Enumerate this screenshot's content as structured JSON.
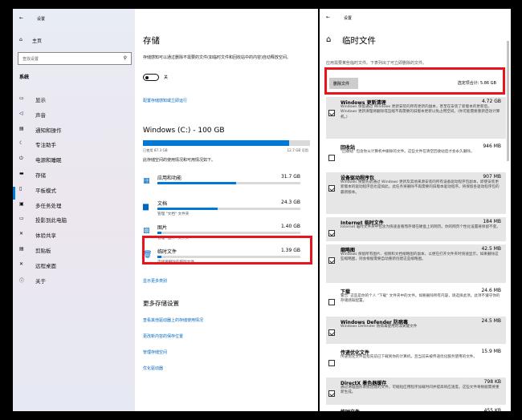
{
  "left_window": {
    "title": "设置",
    "back_icon": "back-arrow-icon",
    "home": "主页",
    "search_placeholder": "查找设置",
    "system_header": "系统",
    "nav": [
      {
        "icon": "display-icon",
        "label": "显示"
      },
      {
        "icon": "sound-icon",
        "label": "声音"
      },
      {
        "icon": "notifications-icon",
        "label": "通知和操作"
      },
      {
        "icon": "focus-assist-icon",
        "label": "专注助手"
      },
      {
        "icon": "power-icon",
        "label": "电源和睡眠"
      },
      {
        "icon": "storage-icon",
        "label": "存储"
      },
      {
        "icon": "tablet-icon",
        "label": "平板模式"
      },
      {
        "icon": "multitask-icon",
        "label": "多任务处理"
      },
      {
        "icon": "project-icon",
        "label": "投影到此电脑"
      },
      {
        "icon": "shared-icon",
        "label": "体验共享"
      },
      {
        "icon": "clipboard-icon",
        "label": "剪贴板"
      },
      {
        "icon": "remote-desktop-icon",
        "label": "远程桌面"
      },
      {
        "icon": "info-icon",
        "label": "关于"
      }
    ],
    "main": {
      "title": "存储",
      "description": "存储感知可以通过删除不需要的文件(如临时文件和回收站中的内容)自动释放空间。",
      "toggle_label": "关",
      "configure_link": "配置存储感知或立即运行",
      "drive_title": "Windows (C:) - 100 GB",
      "used": "已使用 87.3 GB",
      "free": "12.7 GB 可用",
      "used_fraction": 0.873,
      "drive_desc": "此存储空间的使用情况和可用情况如下。",
      "categories": [
        {
          "icon": "apps-icon",
          "name": "应用和功能",
          "size": "31.7 GB",
          "fraction": 0.55,
          "desc": ""
        },
        {
          "icon": "documents-icon",
          "name": "文档",
          "size": "24.3 GB",
          "fraction": 0.42,
          "desc": "管理 \"文档\" 文件夹"
        },
        {
          "icon": "pictures-icon",
          "name": "图片",
          "size": "1.40 GB",
          "fraction": 0.03,
          "desc": "管理 \"图片\" 文件夹"
        },
        {
          "icon": "trash-icon",
          "name": "临时文件",
          "size": "1.39 GB",
          "fraction": 0.03,
          "desc": "选择要删除的临时文件"
        }
      ],
      "show_more": "显示更多类别",
      "more_header": "更多存储设置",
      "more_links": [
        "查看其他驱动器上的存储使用情况",
        "更改新内容的保存位置",
        "管理存储空间",
        "优化驱动器"
      ]
    }
  },
  "right_window": {
    "title": "设置",
    "page_title": "临时文件",
    "intro": "应用需要某些临时文件。下表列出了可立即删除的文件。",
    "delete_button": "删除文件",
    "selected_total": "选定项合计: 5.86 GB",
    "items": [
      {
        "name": "Windows 更新清理",
        "size": "4.72 GB",
        "checked": true,
        "desc": "Windows 保留通过 Windows 更新安装的所有更新的副本，甚至在安装了新版本的更新后。Windows 更新清理将删除或压缩不再需要的旧版本更新以免占用空间。(你可能需要重新启动计算机。)"
      },
      {
        "name": "回收站",
        "size": "946 MB",
        "checked": false,
        "desc": "\"回收站\" 包含你从计算机中删除的文件。这些文件在清空回收站后才会永久删除。"
      },
      {
        "name": "设备驱动程序包",
        "size": "907 MB",
        "checked": true,
        "desc": "Windows 保留先前通过 Windows 更新及其他来源安装的所有设备驱动程序包副本，即使安装更新版本的驱动程序后也是如此。此任务将删除不再需要的旧版本驱动程序。将保留各驱动程序包的最新版本。"
      },
      {
        "name": "Internet 临时文件",
        "size": "184 MB",
        "checked": true,
        "desc": "Internet 临时文件夹中包含为快速查看而存储在硬盘上的网页。你的网页个性化设置将保留不变。"
      },
      {
        "name": "缩略图",
        "size": "42.5 MB",
        "checked": true,
        "desc": "Windows 保留所有图片、视频和文档缩略图的副本，以便在打开文件夹时快速显示。如果删除这些缩略图，则会根据需要自动重新创建这些缩略图。"
      },
      {
        "name": "下载",
        "size": "24.6 MB",
        "checked": false,
        "desc": "警告: 这些是你的个人 \"下载\" 文件夹中的文件。如要删除所有内容，请选择此项。此项不遵守你的存储感知配置。"
      },
      {
        "name": "Windows Defender 防病毒",
        "size": "24.5 MB",
        "checked": true,
        "desc": "Windows Defender 防病毒使用的非关键文件"
      },
      {
        "name": "传递优化文件",
        "size": "15.9 MB",
        "checked": false,
        "desc": "传递优化文件是指先前已下载到你的计算机，且当前未被传递优化服务使用的文件。"
      },
      {
        "name": "DirectX 着色器缓存",
        "size": "798 KB",
        "checked": true,
        "desc": "通过清理图形系统创建的文件，可缩短应用程序加载时间并提高响应速度。这些文件将根据需要重新生成。"
      },
      {
        "name": "临时文件",
        "size": "455 KB",
        "checked": false,
        "desc": ""
      }
    ]
  }
}
